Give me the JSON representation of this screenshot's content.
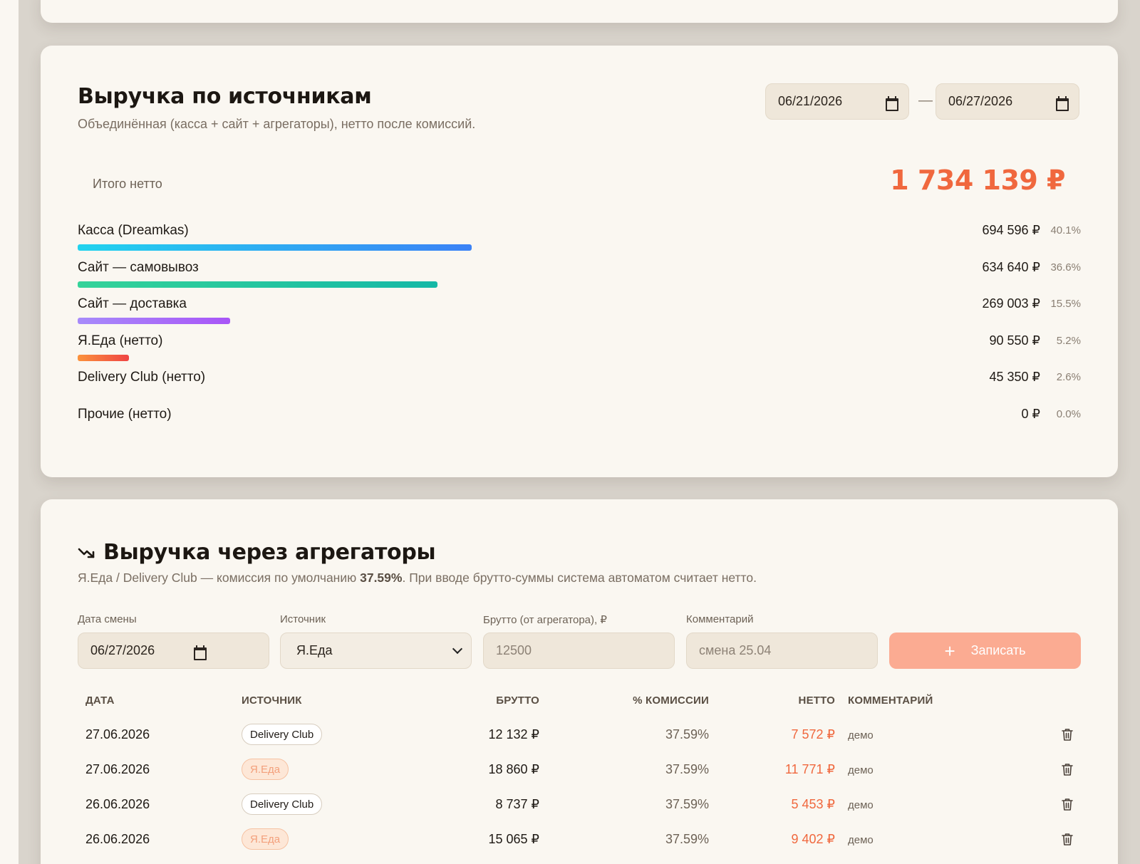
{
  "sources": {
    "title": "Выручка по источникам",
    "subtitle": "Объединённая (касса + сайт + агрегаторы), нетто после комиссий.",
    "date_from": "06/21/2026",
    "date_to": "06/27/2026",
    "date_separator": "—",
    "total_label": "Итого нетто",
    "total_value": "1 734 139 ₽",
    "rows": [
      {
        "name": "Касса (Dreamkas)",
        "value": "694 596 ₽",
        "pct": "40.1%",
        "share": 0.401,
        "color_from": "#22d3ee",
        "color_to": "#3b82f6"
      },
      {
        "name": "Сайт — самовывоз",
        "value": "634 640 ₽",
        "pct": "36.6%",
        "share": 0.366,
        "color_from": "#34d399",
        "color_to": "#14b8a6"
      },
      {
        "name": "Сайт — доставка",
        "value": "269 003 ₽",
        "pct": "15.5%",
        "share": 0.155,
        "color_from": "#a78bfa",
        "color_to": "#a855f7"
      },
      {
        "name": "Я.Еда (нетто)",
        "value": "90 550 ₽",
        "pct": "5.2%",
        "share": 0.052,
        "color_from": "#fb923c",
        "color_to": "#ef4444"
      },
      {
        "name": "Delivery Club (нетто)",
        "value": "45 350 ₽",
        "pct": "2.6%",
        "share": 0.0,
        "color_from": "#faf7f1",
        "color_to": "#faf7f1"
      },
      {
        "name": "Прочие (нетто)",
        "value": "0 ₽",
        "pct": "0.0%",
        "share": 0.0,
        "color_from": "#faf7f1",
        "color_to": "#faf7f1"
      }
    ]
  },
  "aggregators": {
    "title": "Выручка через агрегаторы",
    "subtitle_prefix": "Я.Еда / Delivery Club — комиссия по умолчанию ",
    "commission": "37.59%",
    "subtitle_suffix": ". При вводе брутто-суммы система автоматом считает нетто.",
    "form": {
      "date_label": "Дата смены",
      "date_value": "06/27/2026",
      "source_label": "Источник",
      "source_value": "Я.Еда",
      "gross_label": "Брутто (от агрегатора), ₽",
      "gross_placeholder": "12500",
      "comment_label": "Комментарий",
      "comment_placeholder": "смена 25.04",
      "submit_label": "Записать"
    },
    "columns": [
      "ДАТА",
      "ИСТОЧНИК",
      "БРУТТО",
      "% КОМИССИИ",
      "НЕТТО",
      "КОММЕНТАРИЙ"
    ],
    "rows": [
      {
        "date": "27.06.2026",
        "source": "Delivery Club",
        "source_kind": "dc",
        "gross": "12 132 ₽",
        "pct": "37.59%",
        "net": "7 572 ₽",
        "comment": "демо"
      },
      {
        "date": "27.06.2026",
        "source": "Я.Еда",
        "source_kind": "ya",
        "gross": "18 860 ₽",
        "pct": "37.59%",
        "net": "11 771 ₽",
        "comment": "демо"
      },
      {
        "date": "26.06.2026",
        "source": "Delivery Club",
        "source_kind": "dc",
        "gross": "8 737 ₽",
        "pct": "37.59%",
        "net": "5 453 ₽",
        "comment": "демо"
      },
      {
        "date": "26.06.2026",
        "source": "Я.Еда",
        "source_kind": "ya",
        "gross": "15 065 ₽",
        "pct": "37.59%",
        "net": "9 402 ₽",
        "comment": "демо"
      }
    ]
  },
  "colors": {
    "accent": "#f0683e",
    "submit_bg": "#fbab92",
    "card_bg": "#faf7f1",
    "page_bg": "#d9d4cc"
  }
}
